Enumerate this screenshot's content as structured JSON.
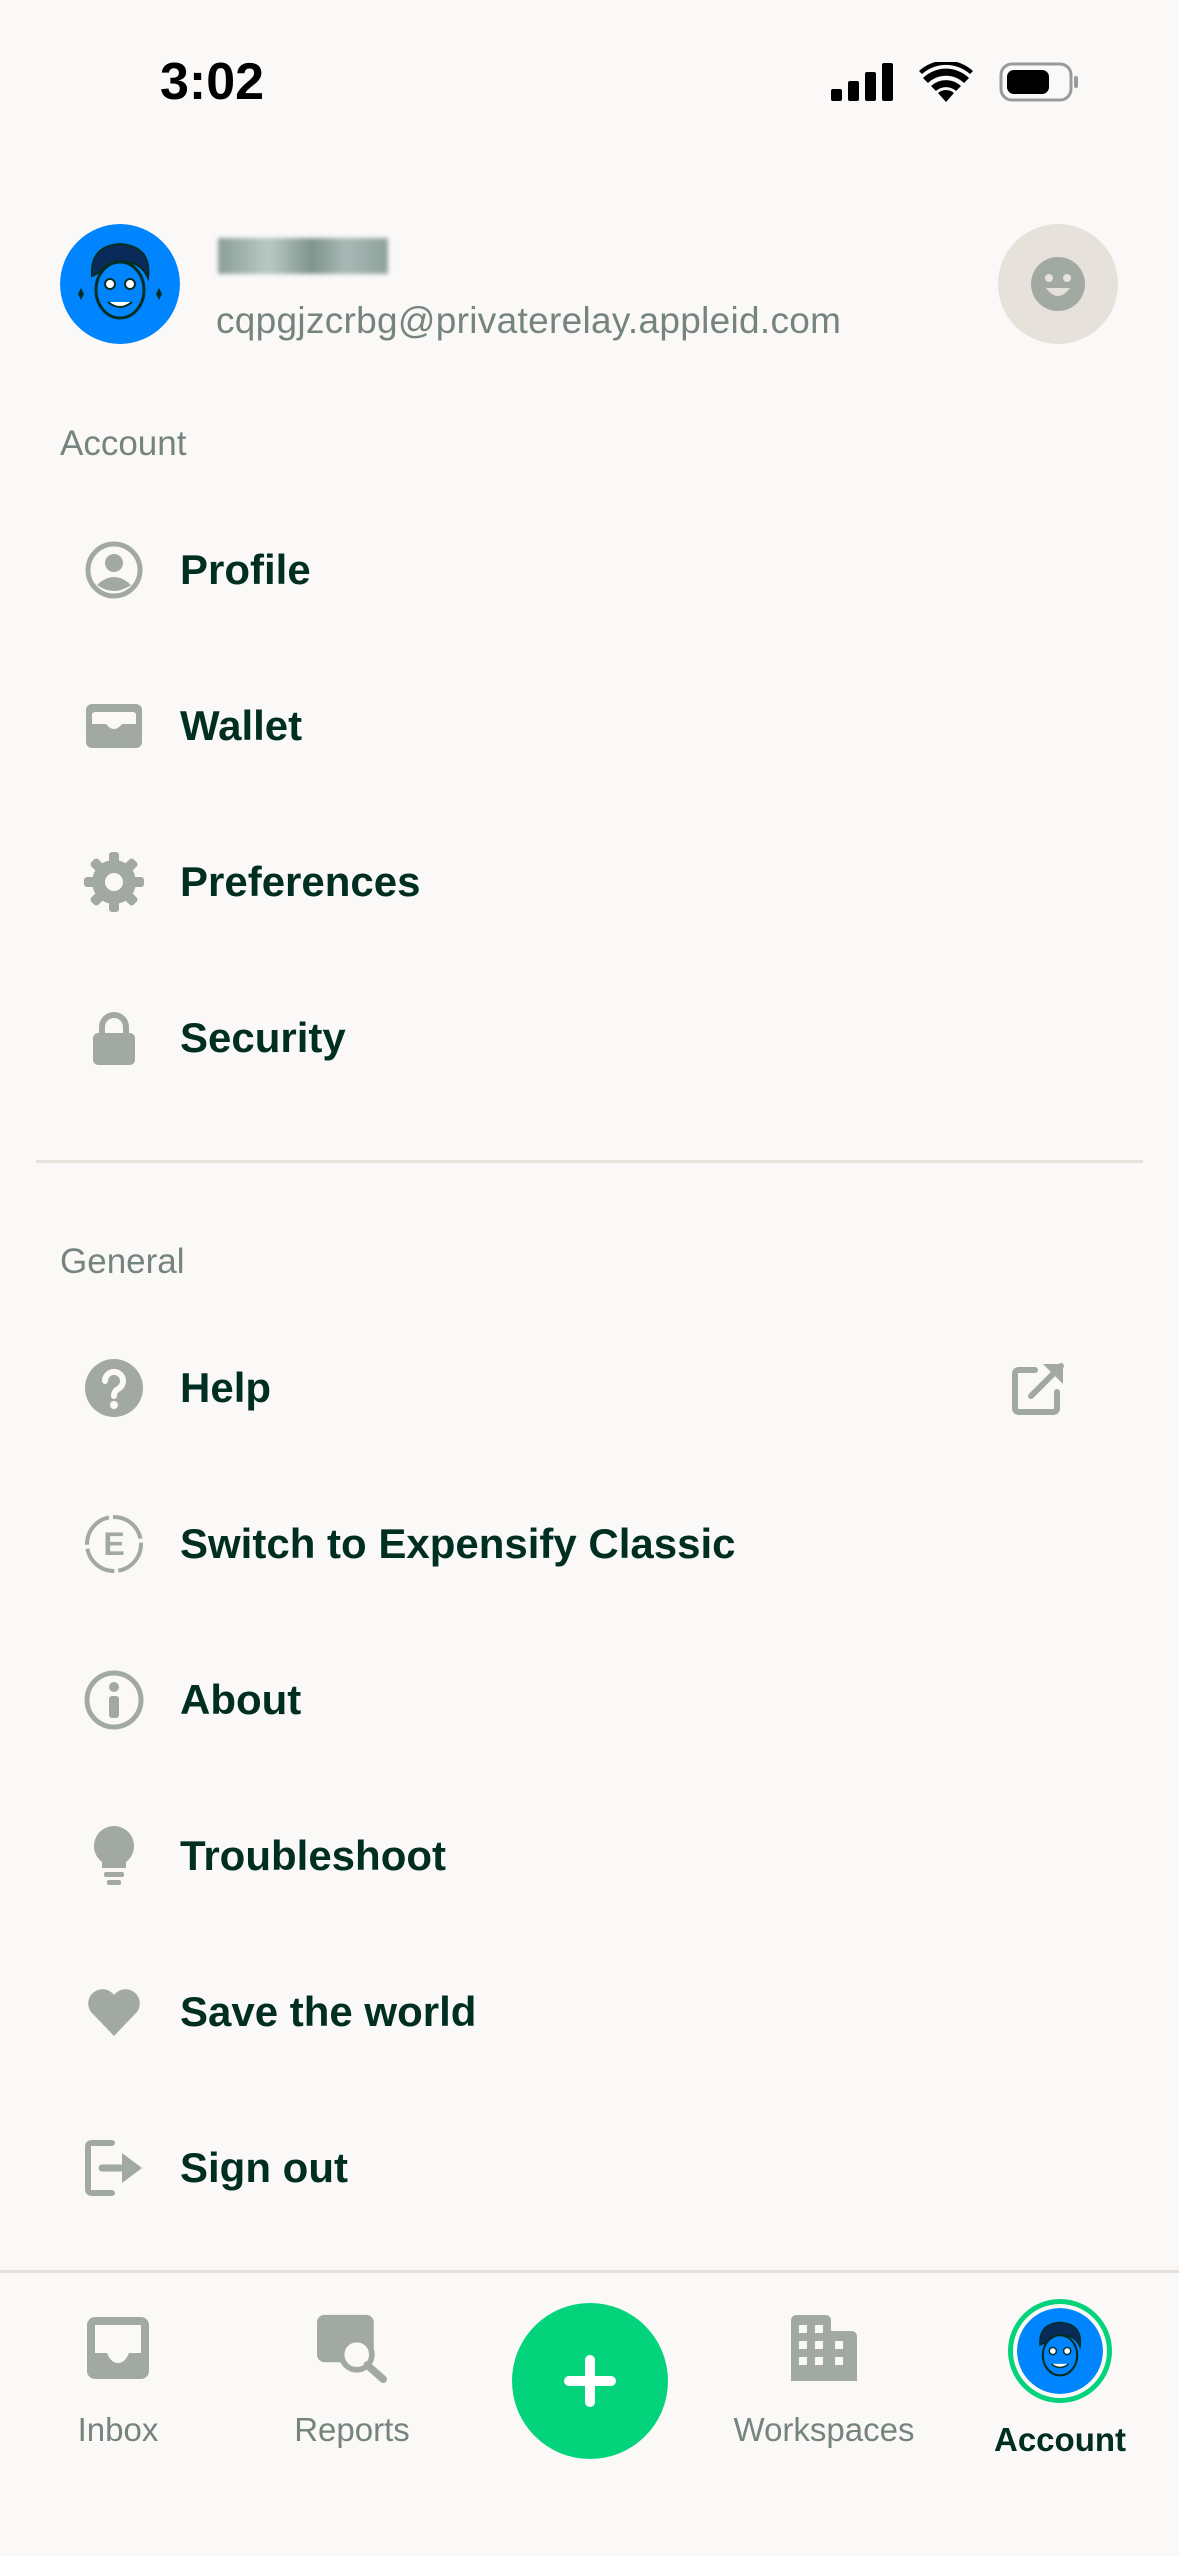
{
  "status_bar": {
    "time": "3:02"
  },
  "header": {
    "email": "cqpgjzcrbg@privaterelay.appleid.com"
  },
  "account_section": {
    "title": "Account",
    "items": [
      {
        "label": "Profile",
        "icon": "profile-icon"
      },
      {
        "label": "Wallet",
        "icon": "wallet-icon"
      },
      {
        "label": "Preferences",
        "icon": "gear-icon"
      },
      {
        "label": "Security",
        "icon": "lock-icon"
      }
    ]
  },
  "general_section": {
    "title": "General",
    "items": [
      {
        "label": "Help",
        "icon": "question-icon",
        "trailing_icon": "external-link-icon"
      },
      {
        "label": "Switch to Expensify Classic",
        "icon": "expensify-classic-icon"
      },
      {
        "label": "About",
        "icon": "info-icon"
      },
      {
        "label": "Troubleshoot",
        "icon": "lightbulb-icon"
      },
      {
        "label": "Save the world",
        "icon": "heart-icon"
      },
      {
        "label": "Sign out",
        "icon": "sign-out-icon"
      }
    ]
  },
  "tabbar": {
    "items": [
      {
        "label": "Inbox",
        "icon": "inbox-icon",
        "active": false
      },
      {
        "label": "Reports",
        "icon": "reports-icon",
        "active": false
      },
      {
        "label": "Workspaces",
        "icon": "building-icon",
        "active": false
      },
      {
        "label": "Account",
        "icon": "avatar",
        "active": true
      }
    ],
    "fab_icon": "plus-icon"
  },
  "colors": {
    "background": "#fbf9f7",
    "text": "#002e22",
    "muted": "#76847e",
    "icon": "#a2a9a3",
    "accent": "#03d47c",
    "avatar_blue": "#0185ff"
  }
}
